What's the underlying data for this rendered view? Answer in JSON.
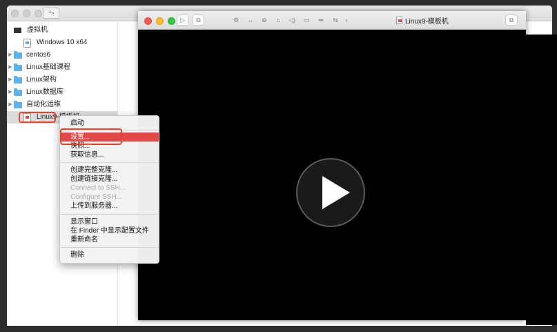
{
  "library": {
    "add_button": "+",
    "root_label": "虚拟机",
    "items": [
      {
        "label": "Windows 10 x64",
        "type": "vm"
      },
      {
        "label": "centos6",
        "type": "folder"
      },
      {
        "label": "Linux基础课程",
        "type": "folder"
      },
      {
        "label": "Linux架构",
        "type": "folder"
      },
      {
        "label": "Linux数据库",
        "type": "folder"
      },
      {
        "label": "自动化运维",
        "type": "folder"
      },
      {
        "label": "Linux9-模板机",
        "type": "vm",
        "selected": true
      }
    ]
  },
  "vm_window": {
    "title": "Linux9-模板机",
    "toolbar_icons": [
      "play-icon",
      "snapshot-icon",
      "settings-icon",
      "resize-icon",
      "hdd-icon",
      "disk-icon",
      "sound-icon",
      "camera-icon",
      "usb-icon",
      "share-icon",
      "collapse-icon"
    ],
    "right_button": "restore-icon"
  },
  "context_menu": {
    "items": [
      {
        "label": "启动",
        "disabled": false
      },
      {
        "label": "设置...",
        "disabled": false,
        "highlighted": true
      },
      {
        "label": "快照...",
        "disabled": false
      },
      {
        "label": "获取信息...",
        "disabled": false
      },
      {
        "label": "创建完整克隆...",
        "disabled": false
      },
      {
        "label": "创建链接克隆...",
        "disabled": false
      },
      {
        "label": "Connect to SSH...",
        "disabled": true
      },
      {
        "label": "Configure SSH...",
        "disabled": true
      },
      {
        "label": "上传到服务器...",
        "disabled": false
      },
      {
        "label": "显示窗口",
        "disabled": false
      },
      {
        "label": "在 Finder 中显示配置文件",
        "disabled": false
      },
      {
        "label": "重新命名",
        "disabled": false
      },
      {
        "label": "删除",
        "disabled": false
      }
    ]
  },
  "colors": {
    "highlight": "#e0484a",
    "annotation_box": "#e2462b",
    "folder": "#5eb3e8"
  }
}
